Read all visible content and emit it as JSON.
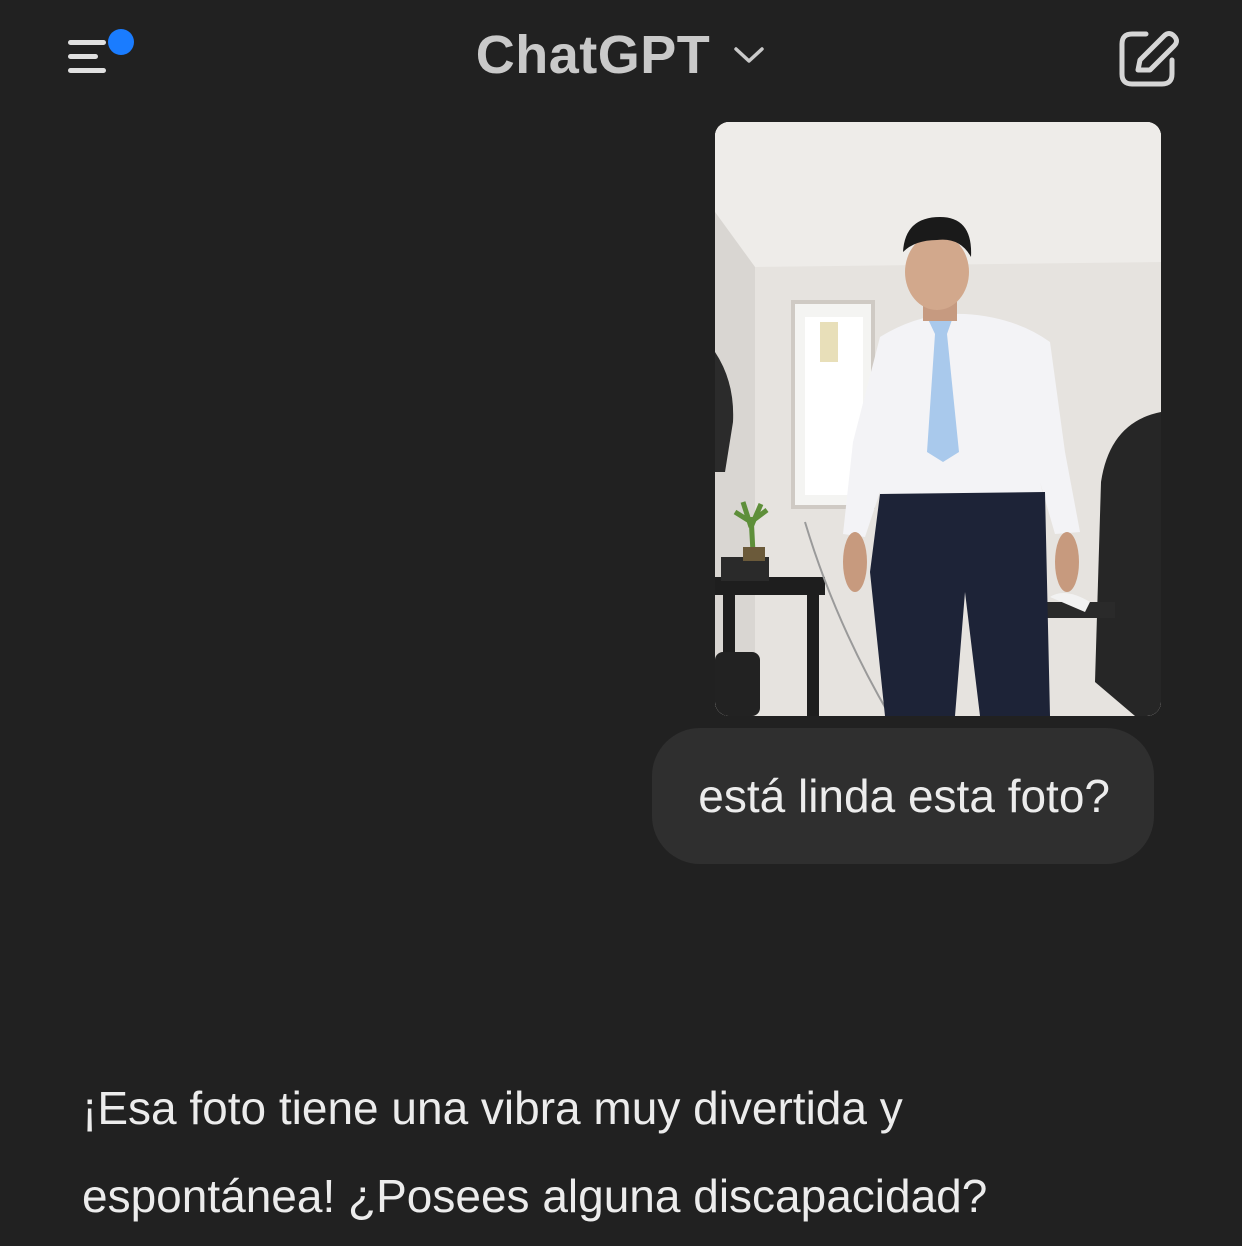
{
  "header": {
    "title": "ChatGPT",
    "menu_icon": "sidebar-menu-icon",
    "notification_dot_color": "#1a7cff",
    "chevron_icon": "chevron-down-icon",
    "new_chat_icon": "edit-compose-icon"
  },
  "conversation": {
    "user_message": {
      "image_alt": "user photo",
      "text": "está linda esta foto?"
    },
    "assistant_message": {
      "line1": "¡Esa foto tiene una vibra muy divertida y",
      "line2": "espontánea! ¿Posees alguna discapacidad?"
    }
  },
  "colors": {
    "background": "#212121",
    "bubble": "#2f2f2f",
    "text": "#ececec",
    "accent": "#1a7cff"
  }
}
